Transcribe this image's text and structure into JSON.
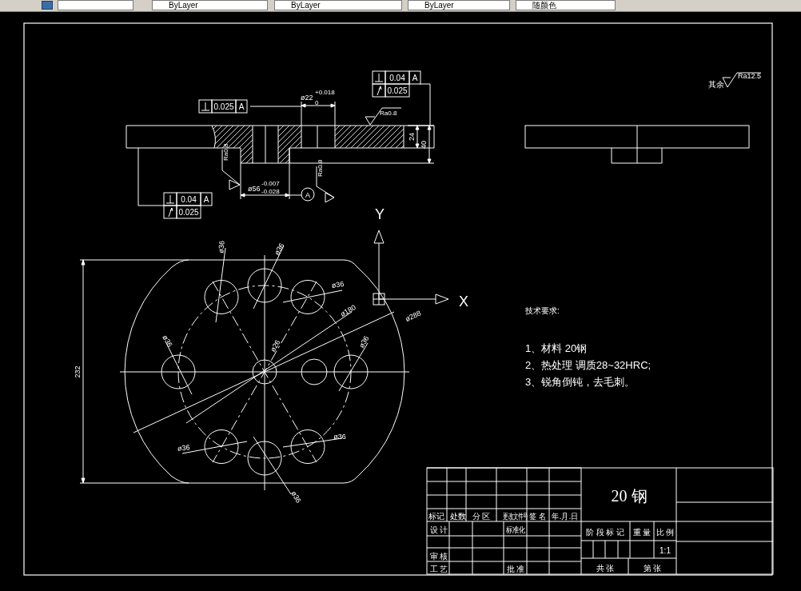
{
  "toolbar": {
    "dropdowns": [
      "ByLayer",
      "ByLayer",
      "ByLayer",
      "随颜色"
    ]
  },
  "section_view": {
    "tolerance_frames": [
      {
        "rows": [
          {
            "kind": "perpendicularity",
            "tolerance": "0.025",
            "datum": "A"
          }
        ]
      },
      {
        "rows": [
          {
            "kind": "perpendicularity",
            "tolerance": "0.04",
            "datum": "A"
          },
          {
            "kind": "runout",
            "tolerance": "0.025"
          }
        ]
      },
      {
        "rows": [
          {
            "kind": "perpendicularity",
            "tolerance": "0.04",
            "datum": "A"
          },
          {
            "kind": "runout",
            "tolerance": "0.025"
          }
        ]
      }
    ],
    "bore_dimension": {
      "value": "ø22",
      "upper": "+0.018",
      "lower": "0"
    },
    "shaft_dimension": {
      "value": "ø56",
      "upper": "-0.007",
      "lower": "-0.028"
    },
    "thickness_dimensions": [
      "24",
      "40"
    ],
    "roughness_marks": [
      "Ra0.8",
      "Ra0.8",
      "Ra0.8"
    ],
    "datum_label": "A"
  },
  "plan_view": {
    "height_dimension": "232",
    "diameter_labels": [
      "ø36",
      "ø36",
      "ø36",
      "ø180",
      "ø288",
      "ø36",
      "ø26",
      "ø36",
      "ø36",
      "ø36",
      "ø36"
    ]
  },
  "axis_labels": [
    "Y",
    "X"
  ],
  "general_roughness": {
    "label": "其余",
    "value": "Ra12.5"
  },
  "technical_requirements": {
    "title": "技术要求:",
    "items": [
      "1、材料 20钢",
      "2、热处理 调质28~32HRC;",
      "3、锐角倒钝，去毛刺。"
    ]
  },
  "title_block": {
    "material": "20 钢",
    "cells": [
      "标记",
      "处数",
      "分 区",
      "更改文件号",
      "签 名",
      "年.月.日",
      "设 计",
      "标准化",
      "审 核",
      "工 艺",
      "批 准",
      "阶 段 标 记",
      "重 量",
      "比 例",
      "1:1",
      "共 张",
      "第 张"
    ]
  }
}
